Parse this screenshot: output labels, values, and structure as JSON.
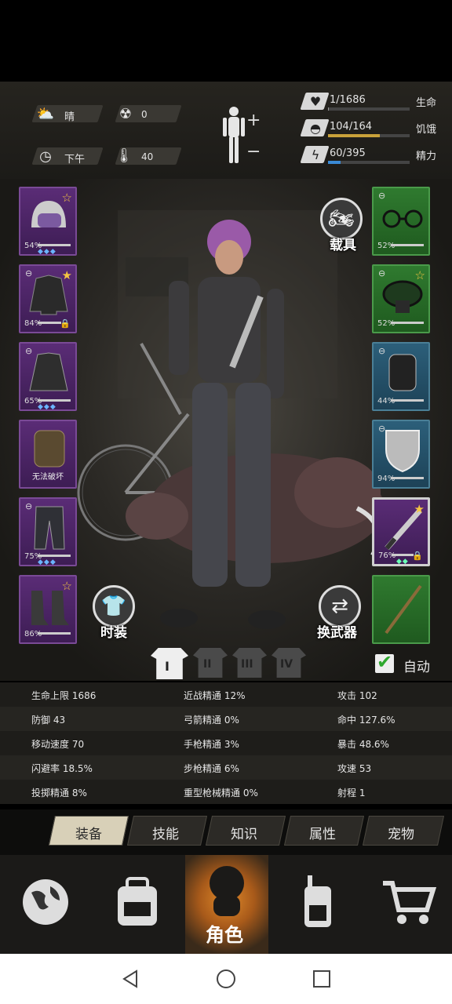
{
  "hud": {
    "weather": "晴",
    "radiation": "0",
    "time_of_day": "下午",
    "temperature": "40",
    "stats": [
      {
        "name": "生命",
        "text": "1/1686",
        "fraction": 0.0006,
        "color": "#999"
      },
      {
        "name": "饥饿",
        "text": "104/164",
        "fraction": 0.634,
        "color": "#c9a23a"
      },
      {
        "name": "精力",
        "text": "60/395",
        "fraction": 0.152,
        "color": "#3a8ad6"
      }
    ],
    "icons": {
      "weather": "partly-cloudy-icon",
      "radiation": "radiation-icon",
      "clock": "clock-icon",
      "thermometer": "thermometer-icon",
      "body": "body-figure-icon"
    }
  },
  "scene": {
    "vehicle_label": "载具",
    "costume_label": "时装",
    "switch_weapon_label": "换武器",
    "auto_label": "自动",
    "auto_checked": true,
    "outfit_tabs": [
      "I",
      "II",
      "III",
      "IV"
    ],
    "outfit_active": 0
  },
  "left_slots": [
    {
      "item": "helmet",
      "pct": "54%",
      "star": true,
      "gems": "◆◆◆"
    },
    {
      "item": "jacket",
      "pct": "84%",
      "star": true,
      "link": true,
      "lock": true
    },
    {
      "item": "coat",
      "pct": "65%",
      "link": true,
      "gems": "◆◆◆"
    },
    {
      "item": "backpack",
      "label": "无法破坏"
    },
    {
      "item": "pants",
      "pct": "75%",
      "link": true,
      "gems": "◆◆◆"
    },
    {
      "item": "boots",
      "pct": "86%",
      "star": true
    }
  ],
  "right_slots": [
    {
      "item": "glasses",
      "pct": "52%",
      "link": true,
      "color": "green"
    },
    {
      "item": "mask",
      "pct": "52%",
      "link": true,
      "star": true,
      "color": "green"
    },
    {
      "item": "gloves",
      "pct": "44%",
      "link": true,
      "color": "teal"
    },
    {
      "item": "shield",
      "pct": "94%",
      "link": true,
      "color": "teal"
    },
    {
      "item": "machete",
      "pct": "76%",
      "star": true,
      "lock": true,
      "gems": "◆◆",
      "color": "purple"
    },
    {
      "item": "bow",
      "color": "green"
    }
  ],
  "stats_table": [
    [
      "生命上限 1686",
      "近战精通 12%",
      "攻击 102"
    ],
    [
      "防御 43",
      "弓箭精通 0%",
      "命中 127.6%"
    ],
    [
      "移动速度 70",
      "手枪精通 3%",
      "暴击 48.6%"
    ],
    [
      "闪避率 18.5%",
      "步枪精通 6%",
      "攻速 53"
    ],
    [
      "投掷精通 8%",
      "重型枪械精通 0%",
      "射程 1"
    ]
  ],
  "tabs": [
    "装备",
    "技能",
    "知识",
    "属性",
    "宠物"
  ],
  "active_tab": 0,
  "bottom_nav": {
    "items": [
      "globe-icon",
      "backpack-icon",
      "character-icon",
      "walkie-talkie-icon",
      "shopping-cart-icon"
    ],
    "active_label": "角色"
  }
}
